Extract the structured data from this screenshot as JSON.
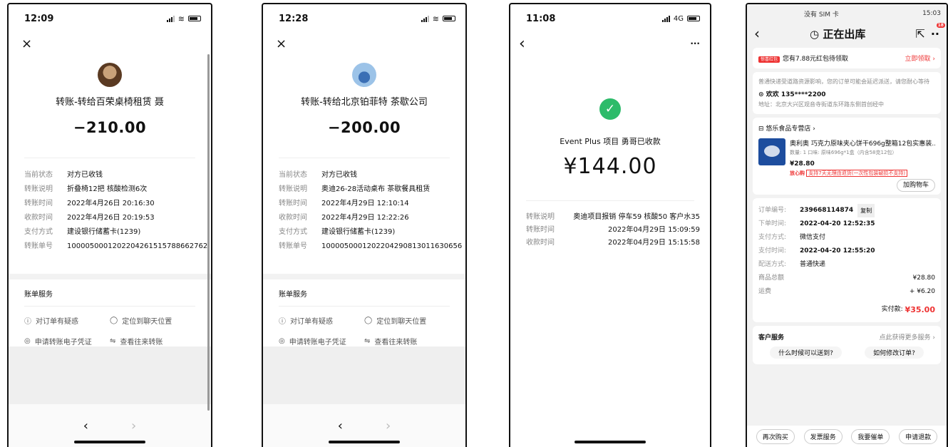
{
  "phone1": {
    "status_time": "12:09",
    "close_icon": "×",
    "payee": "转账-转给百荣桌椅租赁 聂",
    "amount": "−210.00",
    "details": [
      {
        "label": "当前状态",
        "value": "对方已收钱"
      },
      {
        "label": "转账说明",
        "value": "折叠椅12把 核酸检测6次"
      },
      {
        "label": "转账时间",
        "value": "2022年4月26日 20:16:30"
      },
      {
        "label": "收款时间",
        "value": "2022年4月26日 20:19:53"
      },
      {
        "label": "支付方式",
        "value": "建设银行储蓄卡(1239)"
      },
      {
        "label": "转账单号",
        "value": "1000050001202204261515788662762"
      }
    ],
    "service_title": "账单服务",
    "services": [
      "对订单有疑惑",
      "定位到聊天位置",
      "申请转账电子凭证",
      "查看往来转账"
    ],
    "nav_back": "‹",
    "nav_forward": "›"
  },
  "phone2": {
    "status_time": "12:28",
    "close_icon": "×",
    "payee": "转账-转给北京铂菲特 茶歇公司",
    "amount": "−200.00",
    "details": [
      {
        "label": "当前状态",
        "value": "对方已收钱"
      },
      {
        "label": "转账说明",
        "value": "奥迪26-28活动桌布 茶歇餐具租赁"
      },
      {
        "label": "转账时间",
        "value": "2022年4月29日 12:10:14"
      },
      {
        "label": "收款时间",
        "value": "2022年4月29日 12:22:26"
      },
      {
        "label": "支付方式",
        "value": "建设银行储蓄卡(1239)"
      },
      {
        "label": "转账单号",
        "value": "1000050001202204290813011630656"
      }
    ],
    "service_title": "账单服务",
    "services": [
      "对订单有疑惑",
      "定位到聊天位置",
      "申请转账电子凭证",
      "查看往来转账"
    ],
    "nav_back": "‹",
    "nav_forward": "›"
  },
  "phone3": {
    "status_time": "11:08",
    "network": "4G",
    "back": "‹",
    "more": "···",
    "caption": "Event Plus 项目 勇哥已收款",
    "amount": "¥144.00",
    "details": [
      {
        "label": "转账说明",
        "value": "奥迪项目报销 停车59 核酸50 客户水35"
      },
      {
        "label": "转账时间",
        "value": "2022年04月29日 15:09:59"
      },
      {
        "label": "收款时间",
        "value": "2022年04月29日 15:15:58"
      }
    ]
  },
  "phone4": {
    "status_left": "没有 SIM 卡",
    "status_time": "15:03",
    "title": "正在出库",
    "promo_tag": "惊喜红包",
    "promo_text": "您有7.88元红包待领取",
    "promo_action": "立即领取 ›",
    "notice": "普通快递受道路资源影响，您的订单可能会延迟派送，请您耐心等待",
    "receiver": "欢欢 135****2200",
    "address": "地址：北京大兴区观音寺街道东环路东侧首创经中",
    "store": "悠乐食品专营店 ›",
    "product_name": "奥利奥 巧克力原味夹心饼干696g整箱12包实惠装…",
    "product_spec": "数量: 1  口味: 原味696g*1盒（内含58克12包）",
    "product_price": "¥28.80",
    "product_badge": "放心购",
    "product_badge_note": "支持7天无理由退货(一次性包装破损不支持)",
    "add_cart": "加购物车",
    "order_rows": [
      {
        "label": "订单编号:",
        "value": "239668114874",
        "extra": "复制"
      },
      {
        "label": "下单时间:",
        "value": "2022-04-20 12:52:35",
        "extra": ""
      },
      {
        "label": "支付方式:",
        "value": "微信支付",
        "extra": ""
      },
      {
        "label": "支付时间:",
        "value": "2022-04-20 12:55:20",
        "extra": ""
      },
      {
        "label": "配送方式:",
        "value": "普通快递",
        "extra": ""
      }
    ],
    "goods_total_label": "商品总额",
    "goods_total": "¥28.80",
    "shipping_label": "运费",
    "shipping": "+ ¥6.20",
    "paid_label": "实付款:",
    "paid": "¥35.00",
    "cs_title": "客户服务",
    "cs_more": "点此获得更多服务 ›",
    "faq1": "什么时候可以送到?",
    "faq2": "如何修改订单?",
    "actions": [
      "再次购买",
      "发票服务",
      "我要催单",
      "申请退款"
    ],
    "badge_count": "18"
  }
}
